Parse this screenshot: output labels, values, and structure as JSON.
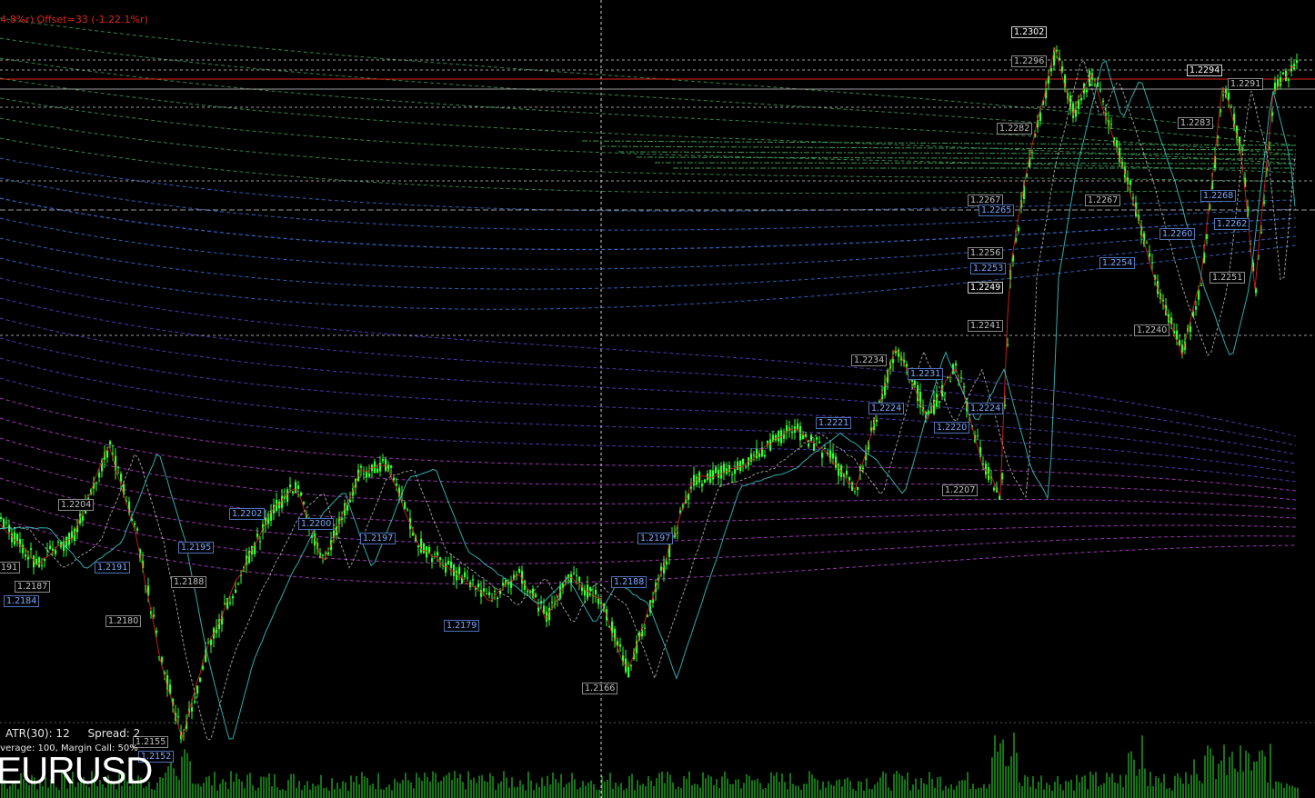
{
  "chart": {
    "symbol": "EURUSD",
    "top_info": "(4.8%r)  Offset=33 (-1.22.1%r)",
    "atr_label": "ATR(30): 12",
    "spread_label": "Spread: 2",
    "leverage_info": "everage: 100, Margin Call: 50%",
    "colors": {
      "background": "#000000",
      "candles": "#33ff33",
      "price_line": "#e0241b",
      "volume": "#33ff33",
      "crosshair": "#cfcfcf"
    }
  },
  "price_labels": [
    {
      "text": "1.2302",
      "kind": "white"
    },
    {
      "text": "1.2296",
      "kind": "hi"
    },
    {
      "text": "1.2294",
      "kind": "white"
    },
    {
      "text": "1.2291",
      "kind": "hi"
    },
    {
      "text": "1.2283",
      "kind": "hi"
    },
    {
      "text": "1.2282",
      "kind": "hi"
    },
    {
      "text": "1.2267",
      "kind": "hi"
    },
    {
      "text": "1.2267",
      "kind": "hi"
    },
    {
      "text": "1.2268",
      "kind": "lo"
    },
    {
      "text": "1.2265",
      "kind": "lo"
    },
    {
      "text": "1.2262",
      "kind": "lo"
    },
    {
      "text": "1.2260",
      "kind": "lo"
    },
    {
      "text": "1.2256",
      "kind": "hi"
    },
    {
      "text": "1.2254",
      "kind": "lo"
    },
    {
      "text": "1.2253",
      "kind": "lo"
    },
    {
      "text": "1.2251",
      "kind": "hi"
    },
    {
      "text": "1.2249",
      "kind": "white"
    },
    {
      "text": "1.2241",
      "kind": "hi"
    },
    {
      "text": "1.2240",
      "kind": "hi"
    },
    {
      "text": "1.2234",
      "kind": "hi"
    },
    {
      "text": "1.2231",
      "kind": "lo"
    },
    {
      "text": "1.2224",
      "kind": "lo"
    },
    {
      "text": "1.2224",
      "kind": "lo"
    },
    {
      "text": "1.2221",
      "kind": "lo"
    },
    {
      "text": "1.2220",
      "kind": "lo"
    },
    {
      "text": "1.2207",
      "kind": "hi"
    },
    {
      "text": "1.2204",
      "kind": "hi"
    },
    {
      "text": "1.2202",
      "kind": "lo"
    },
    {
      "text": "1.2200",
      "kind": "lo"
    },
    {
      "text": "1.2197",
      "kind": "lo"
    },
    {
      "text": "1.2197",
      "kind": "lo"
    },
    {
      "text": "1.2195",
      "kind": "lo"
    },
    {
      "text": "1.2191",
      "kind": "lo"
    },
    {
      "text": "191",
      "kind": "hi"
    },
    {
      "text": "1.2188",
      "kind": "hi"
    },
    {
      "text": "1.2188",
      "kind": "lo"
    },
    {
      "text": "1.2187",
      "kind": "hi"
    },
    {
      "text": "1.2184",
      "kind": "lo"
    },
    {
      "text": "1.2180",
      "kind": "hi"
    },
    {
      "text": "1.2179",
      "kind": "lo"
    },
    {
      "text": "1.2166",
      "kind": "hi"
    },
    {
      "text": "1.2155",
      "kind": "hi"
    },
    {
      "text": "1.2152",
      "kind": "lo"
    }
  ]
}
